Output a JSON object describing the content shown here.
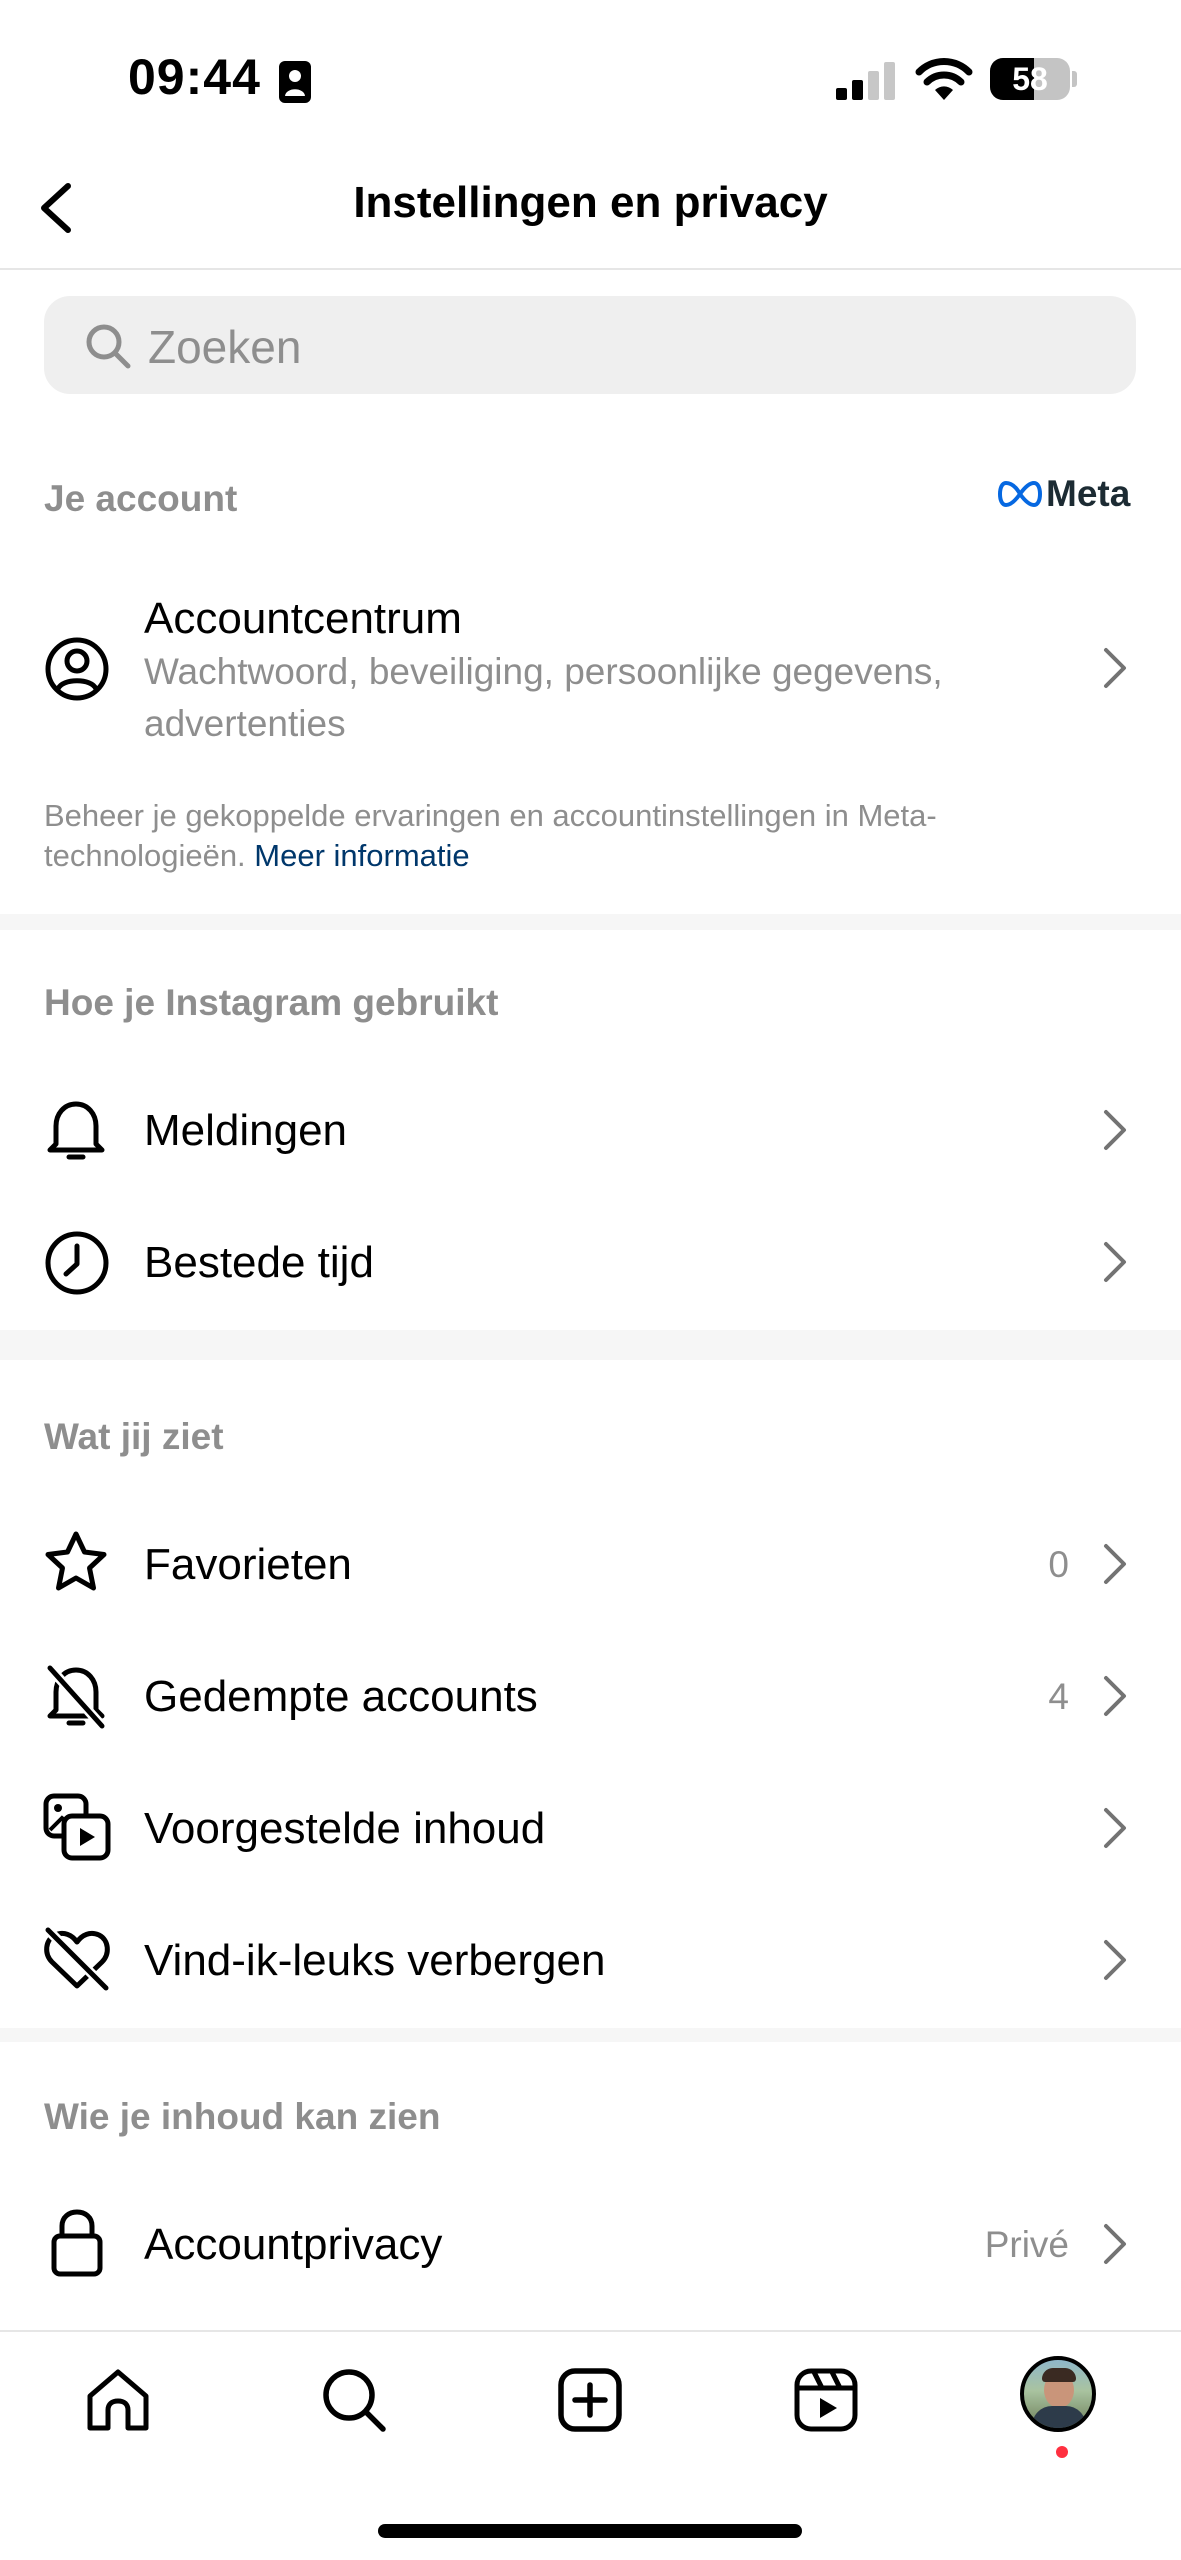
{
  "status_bar": {
    "time": "09:44",
    "battery": "58"
  },
  "header": {
    "title": "Instellingen en privacy"
  },
  "search": {
    "placeholder": "Zoeken"
  },
  "sections": {
    "account": {
      "title": "Je account",
      "brand": "Meta",
      "accountcenter": {
        "label": "Accountcentrum",
        "subtitle_line1": "Wachtwoord, beveiliging, persoonlijke gegevens,",
        "subtitle_line2": "advertenties"
      },
      "info_line1": "Beheer je gekoppelde ervaringen en accountinstellingen in Meta-",
      "info_line2_text": "technologieën.",
      "info_link": "Meer informatie"
    },
    "usage": {
      "title": "Hoe je Instagram gebruikt",
      "items": [
        {
          "label": "Meldingen",
          "icon": "bell-icon"
        },
        {
          "label": "Bestede tijd",
          "icon": "clock-icon"
        }
      ]
    },
    "what_you_see": {
      "title": "Wat jij ziet",
      "items": [
        {
          "label": "Favorieten",
          "value": "0",
          "icon": "star-icon"
        },
        {
          "label": "Gedempte accounts",
          "value": "4",
          "icon": "muted-bell-icon"
        },
        {
          "label": "Voorgestelde inhoud",
          "icon": "suggested-content-icon"
        },
        {
          "label": "Vind-ik-leuks verbergen",
          "icon": "hidden-heart-icon"
        }
      ]
    },
    "who_sees": {
      "title": "Wie je inhoud kan zien",
      "items": [
        {
          "label": "Accountprivacy",
          "value": "Privé",
          "icon": "lock-icon"
        }
      ]
    }
  },
  "colors": {
    "link": "#00376b",
    "meta_blue": "#0668e1",
    "notification_dot": "#ff3040",
    "muted_text": "#8e8e8e"
  }
}
